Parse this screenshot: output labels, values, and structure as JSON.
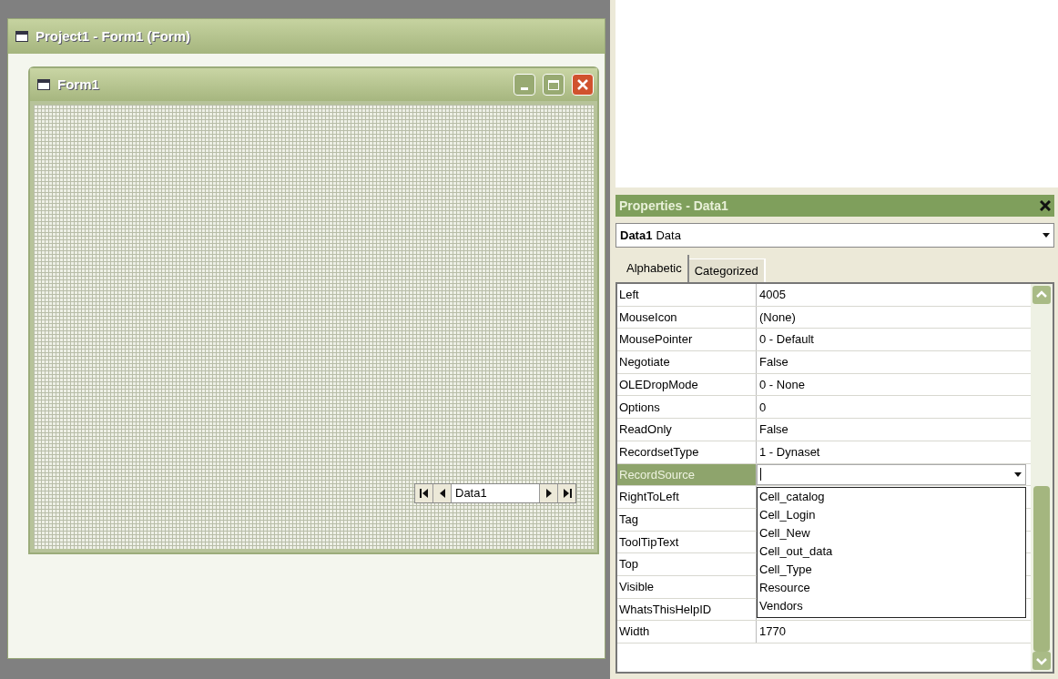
{
  "project_window": {
    "title": "Project1 - Form1 (Form)"
  },
  "form_window": {
    "title": "Form1",
    "data_control": {
      "caption": "Data1"
    }
  },
  "properties": {
    "title": "Properties - Data1",
    "object": {
      "name": "Data1",
      "type": "Data"
    },
    "tabs": [
      {
        "label": "Alphabetic",
        "selected": true
      },
      {
        "label": "Categorized",
        "selected": false
      }
    ],
    "rows": [
      {
        "name": "Left",
        "value": "4005",
        "selected": false
      },
      {
        "name": "MouseIcon",
        "value": "(None)",
        "selected": false
      },
      {
        "name": "MousePointer",
        "value": "0 - Default",
        "selected": false
      },
      {
        "name": "Negotiate",
        "value": "False",
        "selected": false
      },
      {
        "name": "OLEDropMode",
        "value": "0 - None",
        "selected": false
      },
      {
        "name": "Options",
        "value": "0",
        "selected": false
      },
      {
        "name": "ReadOnly",
        "value": "False",
        "selected": false
      },
      {
        "name": "RecordsetType",
        "value": "1 - Dynaset",
        "selected": false
      },
      {
        "name": "RecordSource",
        "selected": true
      },
      {
        "name": "RightToLeft",
        "selected": false
      },
      {
        "name": "Tag",
        "selected": false
      },
      {
        "name": "ToolTipText",
        "selected": false
      },
      {
        "name": "Top",
        "selected": false
      },
      {
        "name": "Visible",
        "selected": false
      },
      {
        "name": "WhatsThisHelpID",
        "selected": false
      },
      {
        "name": "Width",
        "value": "1770",
        "selected": false
      }
    ],
    "dropdown": {
      "items": [
        "Cell_catalog",
        "Cell_Login",
        "Cell_New",
        "Cell_out_data",
        "Cell_Type",
        "Resource",
        "Vendors"
      ]
    }
  }
}
